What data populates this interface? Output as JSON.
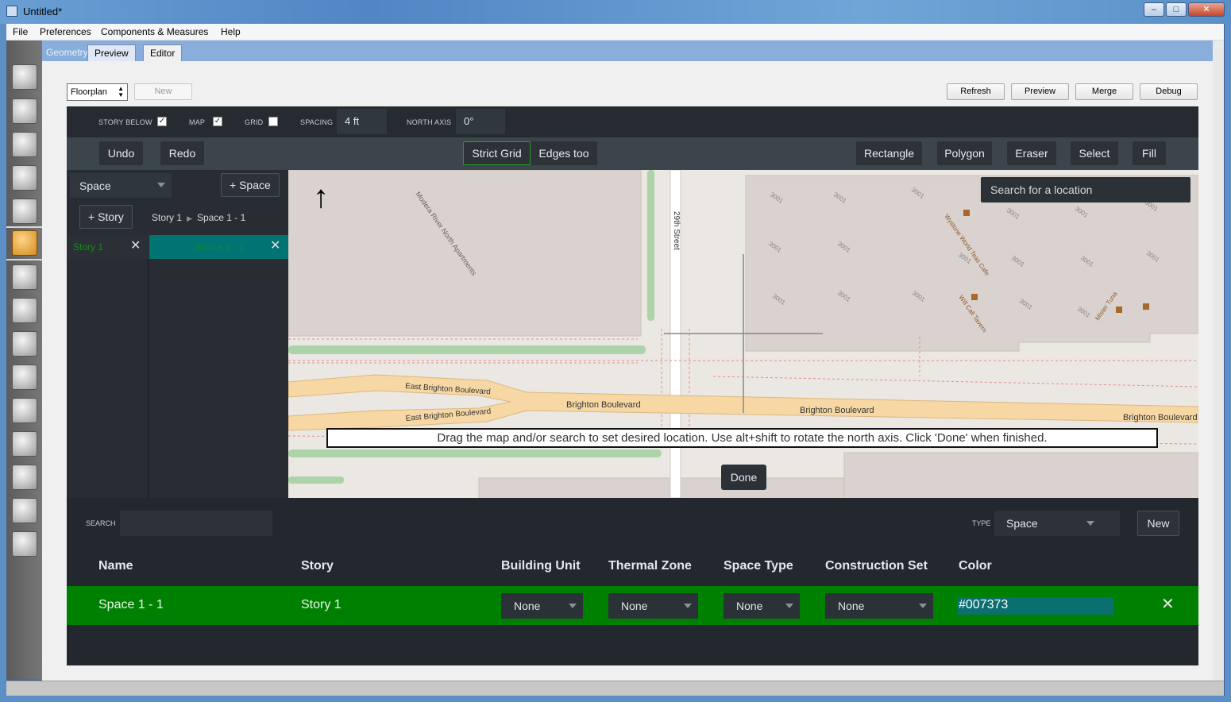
{
  "window": {
    "title": "Untitled*",
    "minimize": "–",
    "maximize": "□",
    "close": "✕"
  },
  "menu": {
    "items": [
      "File",
      "Preferences",
      "Components & Measures",
      "Help"
    ]
  },
  "tabs": {
    "geometry": "Geometry",
    "preview": "Preview",
    "editor": "Editor"
  },
  "toolbar": {
    "view_select": "Floorplan",
    "new_label": "New",
    "refresh_label": "Refresh",
    "preview_label": "Preview",
    "merge_label": "Merge",
    "debug_label": "Debug"
  },
  "settings": {
    "story_below_label": "STORY BELOW",
    "story_below_checked": "✓",
    "map_label": "MAP",
    "map_checked": "✓",
    "grid_label": "GRID",
    "grid_checked": "",
    "spacing_label": "SPACING",
    "spacing_value": "4 ft",
    "north_axis_label": "NORTH AXIS",
    "north_axis_value": "0°"
  },
  "tools": {
    "undo": "Undo",
    "redo": "Redo",
    "strict_grid": "Strict Grid",
    "edges_too": "Edges too",
    "rectangle": "Rectangle",
    "polygon": "Polygon",
    "eraser": "Eraser",
    "select": "Select",
    "fill": "Fill"
  },
  "navigator": {
    "mode": "Space",
    "add_space": "+ Space",
    "add_story": "+ Story",
    "breadcrumb_story": "Story 1",
    "breadcrumb_space": "Space 1 - 1",
    "story_item": "Story 1",
    "space_item": "Space 1 - 1"
  },
  "map": {
    "search_placeholder": "Search for a location",
    "message": "Drag the map and/or search to set desired location. Use alt+shift to rotate the north axis. Click 'Done' when finished.",
    "done_label": "Done",
    "labels": {
      "street": "29th Street",
      "boulevard": "Brighton Boulevard",
      "east_boulevard": "East Brighton Boulevard",
      "apartments": "Modera River North Apartments",
      "num": "3001",
      "cafe": "Wystone World Teas Cafe",
      "tavern": "Will Call Tavern",
      "tuna": "Mister Tuna"
    }
  },
  "bottom": {
    "search_label": "SEARCH",
    "type_label": "TYPE",
    "type_value": "Space",
    "new_label": "New",
    "headers": [
      "Name",
      "Story",
      "Building Unit",
      "Thermal Zone",
      "Space Type",
      "Construction Set",
      "Color"
    ],
    "row": {
      "name": "Space 1 - 1",
      "story": "Story 1",
      "building_unit": "None",
      "thermal_zone": "None",
      "space_type": "None",
      "construction_set": "None",
      "color": "#007373"
    }
  },
  "colors": {
    "accent_green": "#008000",
    "space_color": "#007373",
    "panel_dark": "#22282d"
  }
}
